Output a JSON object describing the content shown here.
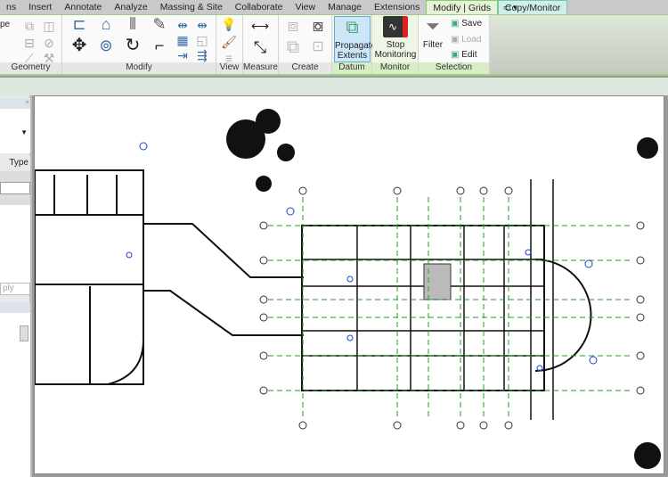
{
  "tabs": [
    {
      "label": "ns"
    },
    {
      "label": "Insert"
    },
    {
      "label": "Annotate"
    },
    {
      "label": "Analyze"
    },
    {
      "label": "Massing & Site"
    },
    {
      "label": "Collaborate"
    },
    {
      "label": "View"
    },
    {
      "label": "Manage"
    },
    {
      "label": "Extensions"
    },
    {
      "label": "Modify | Grids",
      "active": true
    },
    {
      "label": "Copy/Monitor",
      "contextual": true
    }
  ],
  "ribbon": {
    "panels": {
      "geometry": "Geometry",
      "modify": "Modify",
      "view": "View",
      "measure": "Measure",
      "create": "Create",
      "datum": "Datum",
      "monitor": "Monitor",
      "selection": "Selection"
    },
    "buttons": {
      "propagate": "Propagate Extents",
      "stop_monitoring": "Stop Monitoring",
      "filter": "Filter",
      "save": "Save",
      "load": "Load",
      "edit": "Edit"
    },
    "geometry_fragment": "pe"
  },
  "left_panel": {
    "type_label": "Type",
    "apply_button": "ply"
  },
  "colors": {
    "active_tab": "#e4f3d8",
    "contextual_tab": "#cfeee8",
    "grid_line": "#2a9a2a",
    "selection_blue": "#2244cc"
  }
}
